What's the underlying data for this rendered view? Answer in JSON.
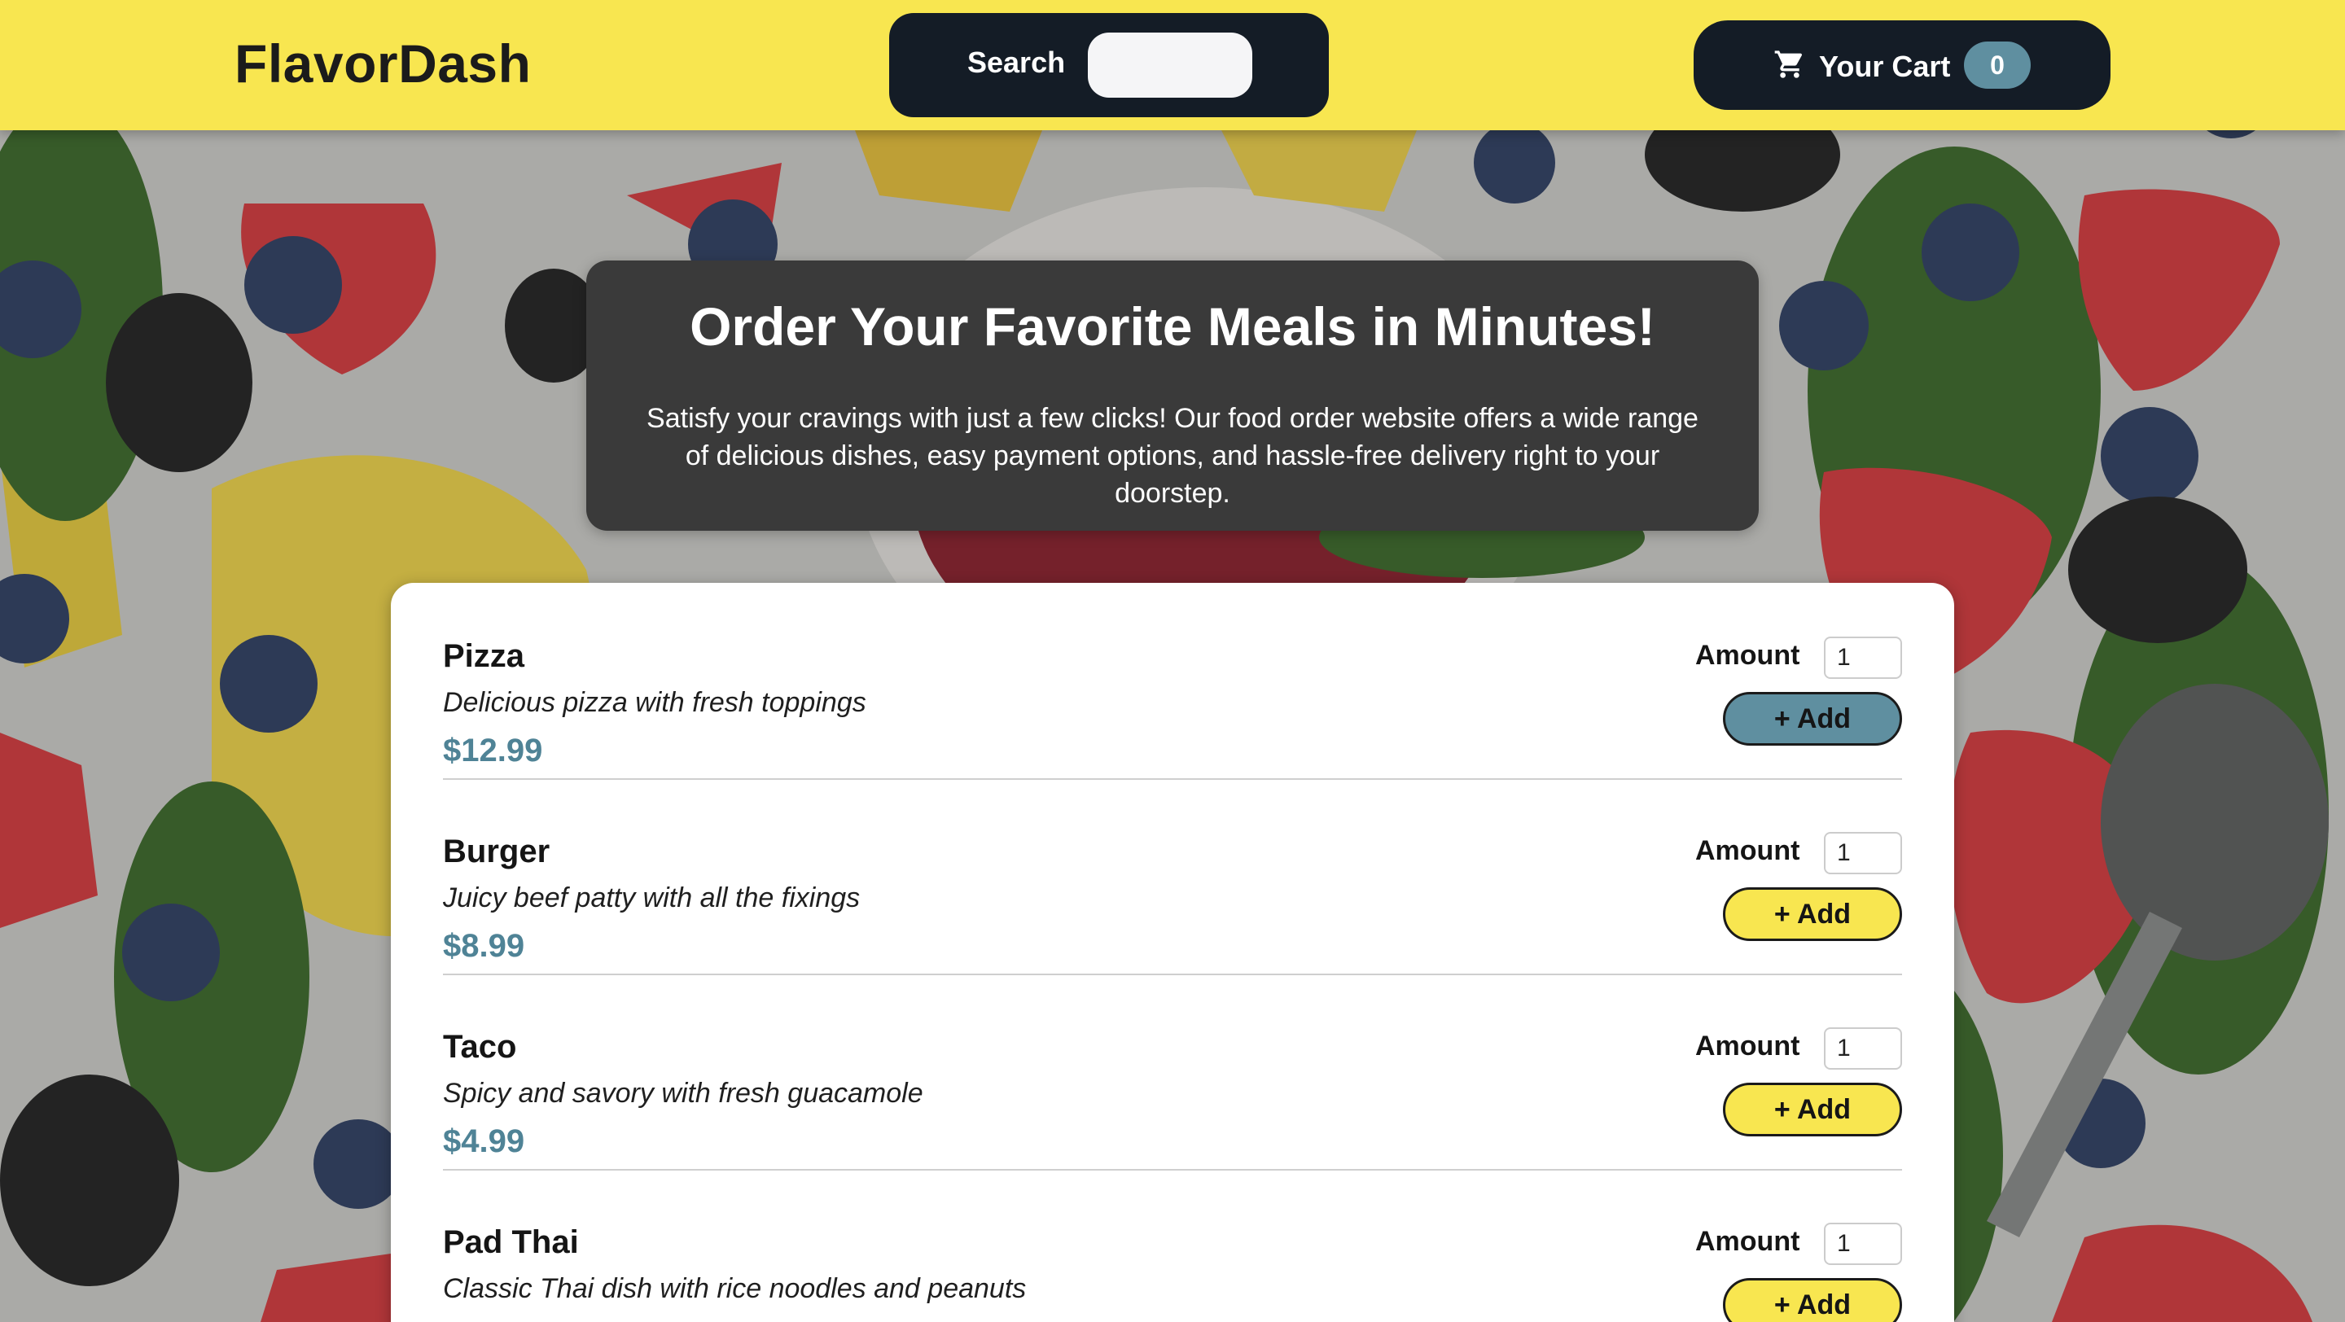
{
  "header": {
    "logo": "FlavorDash",
    "search_label": "Search",
    "search_value": "",
    "search_placeholder": "",
    "cart_label": "Your Cart",
    "cart_count": "0",
    "cart_icon": "shopping-cart-icon"
  },
  "hero": {
    "title": "Order Your Favorite Meals in Minutes!",
    "text": "Satisfy your cravings with just a few clicks! Our food order website offers a wide range of delicious dishes, easy payment options, and hassle-free delivery right to your doorstep."
  },
  "menu": {
    "items": [
      {
        "name": "Pizza",
        "description": "Delicious pizza with fresh toppings",
        "price": "$12.99",
        "amount_label": "Amount",
        "amount": "1",
        "add_label": "+ Add"
      },
      {
        "name": "Burger",
        "description": "Juicy beef patty with all the fixings",
        "price": "$8.99",
        "amount_label": "Amount",
        "amount": "1",
        "add_label": "+ Add"
      },
      {
        "name": "Taco",
        "description": "Spicy and savory with fresh guacamole",
        "price": "$4.99",
        "amount_label": "Amount",
        "amount": "1",
        "add_label": "+ Add"
      },
      {
        "name": "Pad Thai",
        "description": "Classic Thai dish with rice noodles and peanuts",
        "price": "",
        "amount_label": "Amount",
        "amount": "1",
        "add_label": "+ Add"
      }
    ]
  },
  "colors": {
    "header_bg": "#f8e650",
    "dark": "#141c26",
    "accent": "#5f8fa0",
    "price": "#4f8396",
    "hero_bg": "#3a3a3a"
  }
}
